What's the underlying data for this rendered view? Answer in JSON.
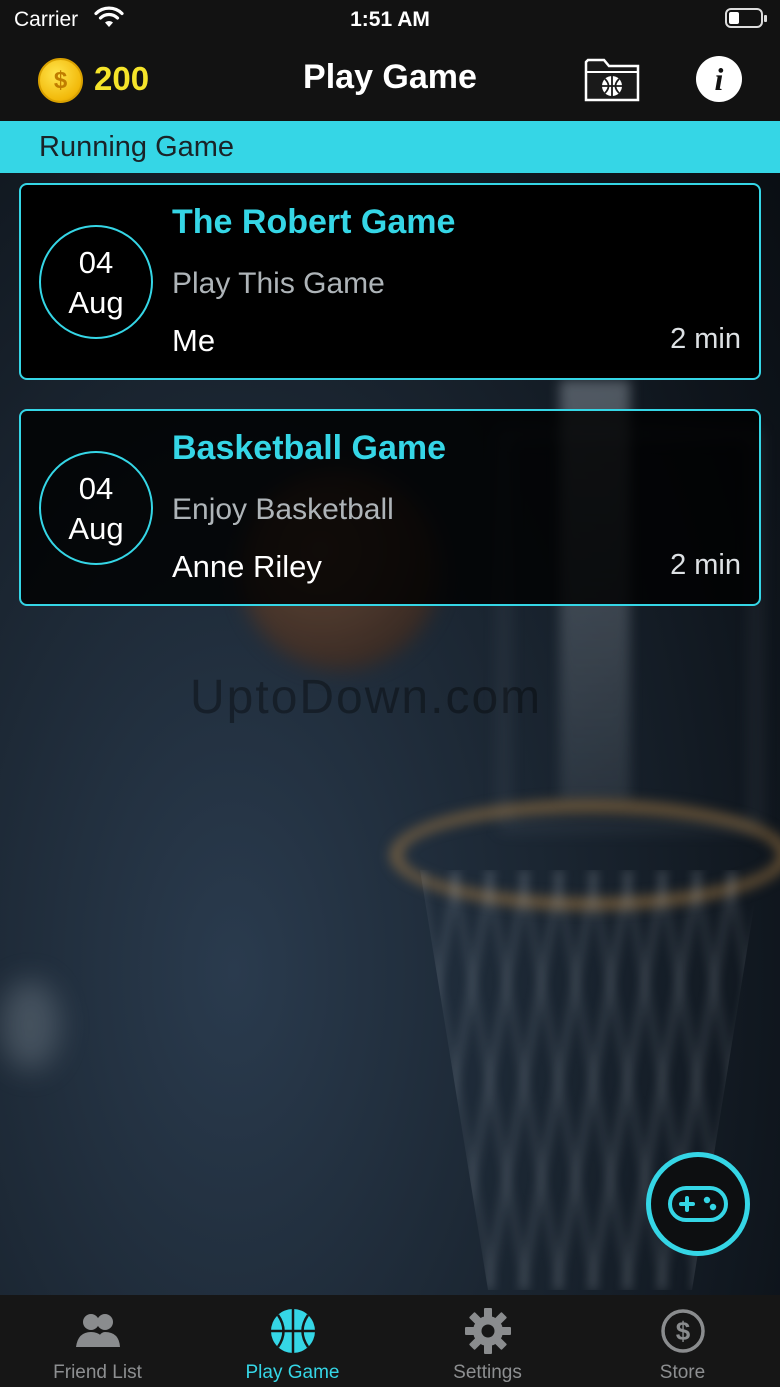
{
  "status_bar": {
    "carrier": "Carrier",
    "time": "1:51 AM"
  },
  "header": {
    "coins": "200",
    "coin_symbol": "$",
    "title": "Play Game",
    "info_symbol": "i"
  },
  "section": {
    "title": "Running Game"
  },
  "games": [
    {
      "day": "04",
      "month": "Aug",
      "title": "The Robert Game",
      "subtitle": "Play This Game",
      "player": "Me",
      "duration": "2 min"
    },
    {
      "day": "04",
      "month": "Aug",
      "title": "Basketball Game",
      "subtitle": "Enjoy Basketball",
      "player": "Anne Riley",
      "duration": "2 min"
    }
  ],
  "tabs": [
    {
      "label": "Friend List",
      "icon": "friends-icon"
    },
    {
      "label": "Play Game",
      "icon": "basketball-icon",
      "active": true
    },
    {
      "label": "Settings",
      "icon": "gear-icon"
    },
    {
      "label": "Store",
      "icon": "dollar-icon"
    }
  ],
  "colors": {
    "accent": "#35d6e6",
    "coin": "#f5e42a",
    "bar": "#121212"
  },
  "watermark": "UptoDown.com"
}
